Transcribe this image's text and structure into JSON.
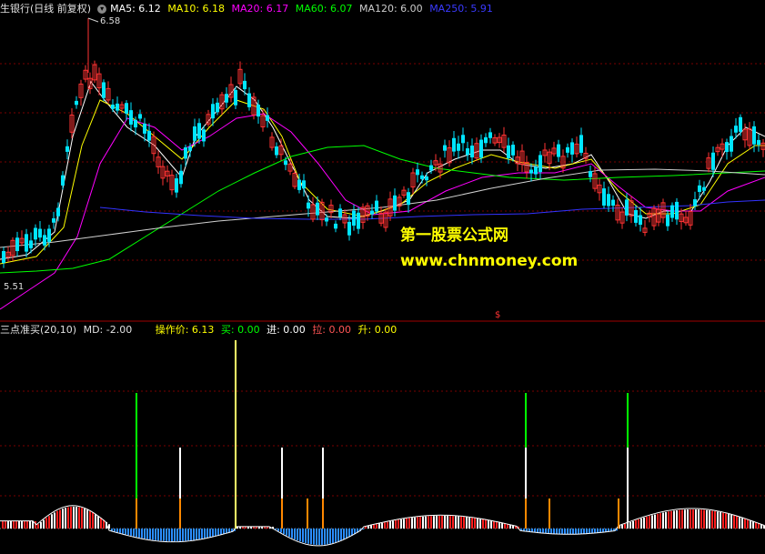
{
  "header": {
    "title": "生银行(日线 前复权)",
    "ma5": "MA5: 6.12",
    "ma10": "MA10: 6.18",
    "ma20": "MA20: 6.17",
    "ma60": "MA60: 6.07",
    "ma120": "MA120: 6.00",
    "ma250": "MA250: 5.91"
  },
  "chart": {
    "high_label": "6.58",
    "low_label": "5.51",
    "marker": "$"
  },
  "indicator": {
    "name": "三点准买(20,10)",
    "md": "MD: -2.00",
    "price_label": "操作价: 6.13",
    "buy": "买: 0.00",
    "enter": "进: 0.00",
    "pull": "拉: 0.00",
    "rise": "升: 0.00"
  },
  "watermark": {
    "cn": "第一股票公式网",
    "url": "www.chnmoney.com"
  },
  "colors": {
    "ma5": "#ffffff",
    "ma10": "#ffff00",
    "ma20": "#ff00ff",
    "ma60": "#00ff00",
    "ma120": "#cccccc",
    "ma250": "#3333ff",
    "up": "#ff3333",
    "down": "#00ffff"
  }
}
